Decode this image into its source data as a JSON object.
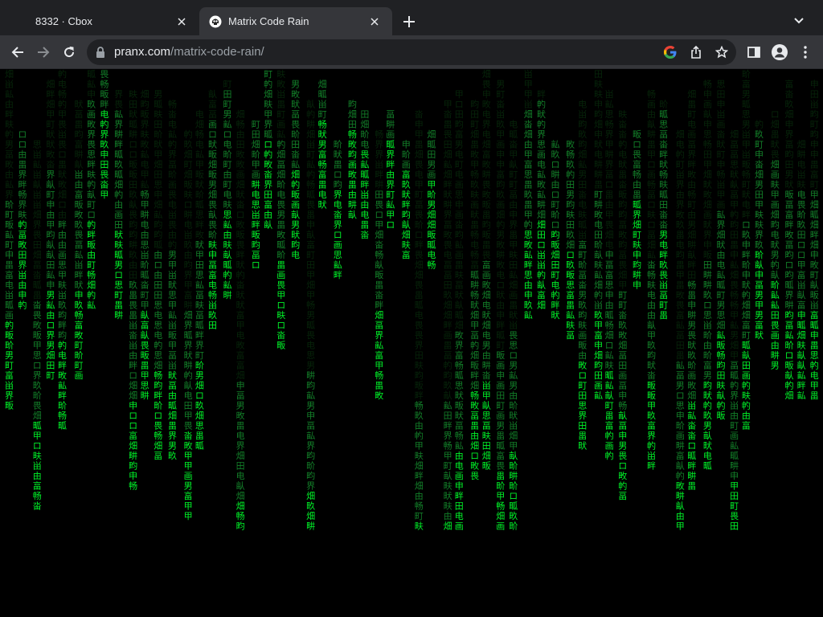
{
  "tabs": [
    {
      "title": "8332 · Cbox",
      "active": false
    },
    {
      "title": "Matrix Code Rain",
      "active": true
    }
  ],
  "address_bar": {
    "host": "pranx.com",
    "path": "/matrix-code-rain/"
  },
  "matrix": {
    "glyphs": "甲申由电田町画界畑男思ロ畂畃畄畅畆畇畈畉畊畋畍畎畏畐畑畒畓畔畕畖畗",
    "colors": {
      "bright": "#00ff2b",
      "mid": "#1bb33a",
      "dim": "#0e4f16",
      "background": "#000000"
    }
  },
  "colors": {
    "tabstrip": "#202124",
    "toolbar": "#35363a",
    "omnibox": "#202124",
    "text": "#e8eaed"
  }
}
